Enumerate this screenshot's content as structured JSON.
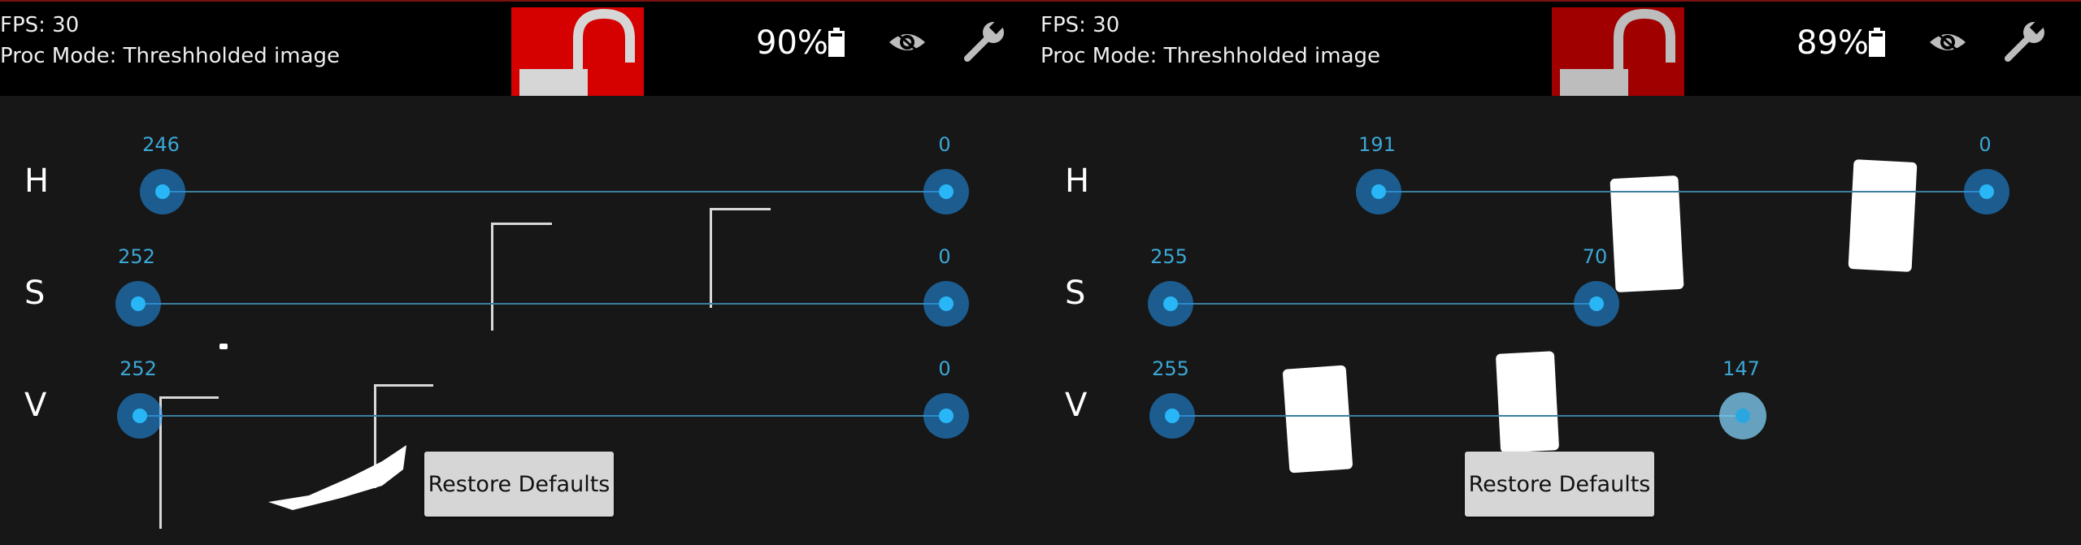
{
  "colors": {
    "accent": "#29b6f6",
    "lock_red": "#d50000",
    "lock_dark_red": "#a00000"
  },
  "panels": [
    {
      "fps": "FPS: 30",
      "proc_mode": "Proc Mode: Threshholded image",
      "battery": "90%",
      "lock_state": "unlocked",
      "sliders": [
        {
          "label": "H",
          "low": "246",
          "high": "0"
        },
        {
          "label": "S",
          "low": "252",
          "high": "0"
        },
        {
          "label": "V",
          "low": "252",
          "high": "0"
        }
      ],
      "restore_label": "Restore Defaults"
    },
    {
      "fps": "FPS: 30",
      "proc_mode": "Proc Mode: Threshholded image",
      "battery": "89%",
      "lock_state": "unlocked",
      "sliders": [
        {
          "label": "H",
          "low": "191",
          "high": "0"
        },
        {
          "label": "S",
          "low": "255",
          "high": "70"
        },
        {
          "label": "V",
          "low": "255",
          "high": "147"
        }
      ],
      "restore_label": "Restore Defaults"
    }
  ],
  "icons": [
    "battery-icon",
    "eye-icon",
    "wrench-icon",
    "unlocked-padlock-icon"
  ]
}
